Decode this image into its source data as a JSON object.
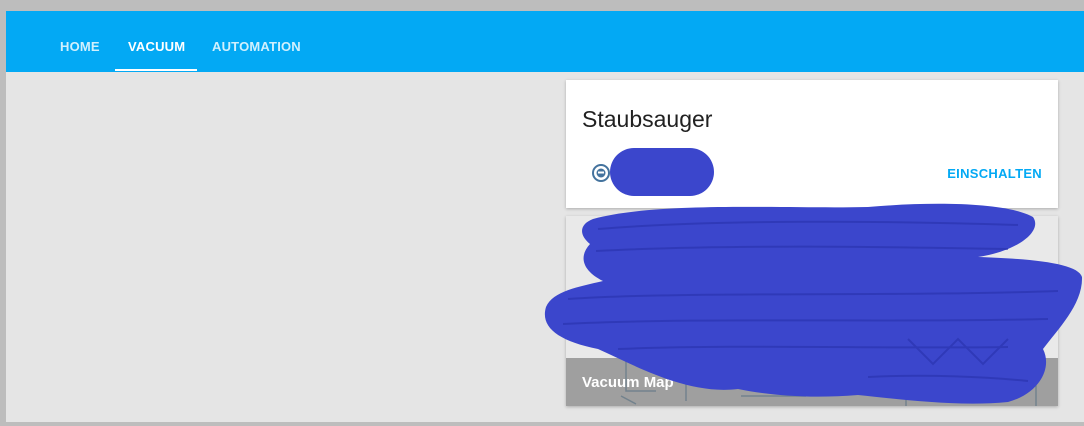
{
  "tabs": [
    {
      "label": "HOME",
      "active": false
    },
    {
      "label": "VACUUM",
      "active": true
    },
    {
      "label": "AUTOMATION",
      "active": false
    }
  ],
  "vacuum_card": {
    "title": "Staubsauger",
    "entity_icon": "robot-vacuum-icon",
    "action_label": "EINSCHALTEN"
  },
  "map_card": {
    "title": "Vacuum Map"
  },
  "colors": {
    "header": "#03a9f4",
    "accent": "#03a9f4",
    "background": "#e5e5e5",
    "redaction": "#3b46cc"
  }
}
